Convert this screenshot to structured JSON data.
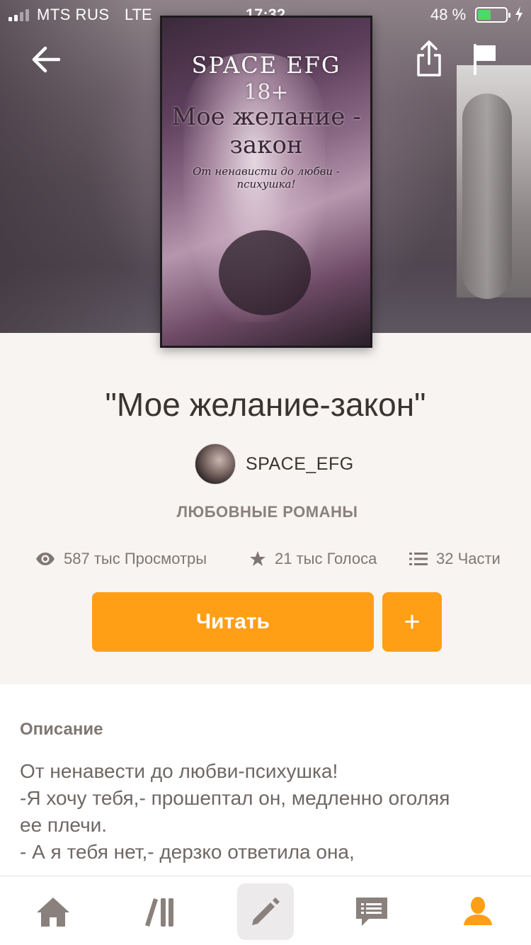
{
  "status_bar": {
    "carrier": "MTS RUS",
    "network": "LTE",
    "time": "17:32",
    "battery_percent": "48 %",
    "battery_level": 0.48
  },
  "cover": {
    "author_text": "SPACE EFG",
    "age_rating": "18+",
    "title_line1": "Мое желание -",
    "title_line2": "закон",
    "tagline": "От ненависти до любви - психушка!"
  },
  "book": {
    "title": "\"Мое желание-закон\"",
    "author": "SPACE_EFG",
    "genre": "ЛЮБОВНЫЕ РОМАНЫ"
  },
  "stats": {
    "views": "587 тыс Просмотры",
    "votes": "21 тыс Голоса",
    "parts": "32 Части"
  },
  "actions": {
    "read_label": "Читать",
    "add_label": "+"
  },
  "description": {
    "heading": "Описание",
    "lines": [
      "От ненавести до любви-психушка!",
      "-Я хочу тебя,- прошептал он, медленно оголяя",
      "ее плечи.",
      "- А я тебя нет,- дерзко ответила она,"
    ]
  },
  "tabs": [
    {
      "name": "home",
      "icon": "home-icon",
      "active": false
    },
    {
      "name": "library",
      "icon": "library-icon",
      "active": false
    },
    {
      "name": "write",
      "icon": "pencil-icon",
      "active": false
    },
    {
      "name": "messages",
      "icon": "messages-icon",
      "active": false
    },
    {
      "name": "profile",
      "icon": "profile-icon",
      "active": true
    }
  ],
  "colors": {
    "accent": "#ff9f16",
    "text_primary": "#3a3430",
    "text_secondary": "#7f7773",
    "background": "#f7f4f1",
    "battery_green": "#4cd964"
  }
}
